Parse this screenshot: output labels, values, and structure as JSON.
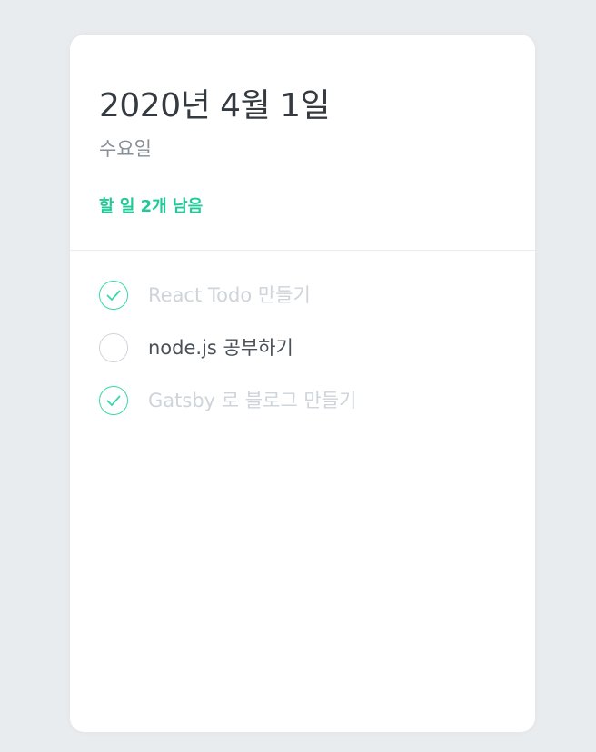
{
  "header": {
    "date": "2020년 4월 1일",
    "day": "수요일",
    "tasks_left": "할 일 2개 남음"
  },
  "todos": [
    {
      "text": "React Todo 만들기",
      "done": true
    },
    {
      "text": "node.js 공부하기",
      "done": false
    },
    {
      "text": "Gatsby 로 블로그 만들기",
      "done": true
    }
  ],
  "colors": {
    "accent": "#20c997",
    "check": "#38d9a9",
    "background": "#e9ecef",
    "done_text": "#ced4da"
  },
  "icons": {
    "checked": "check-icon"
  }
}
